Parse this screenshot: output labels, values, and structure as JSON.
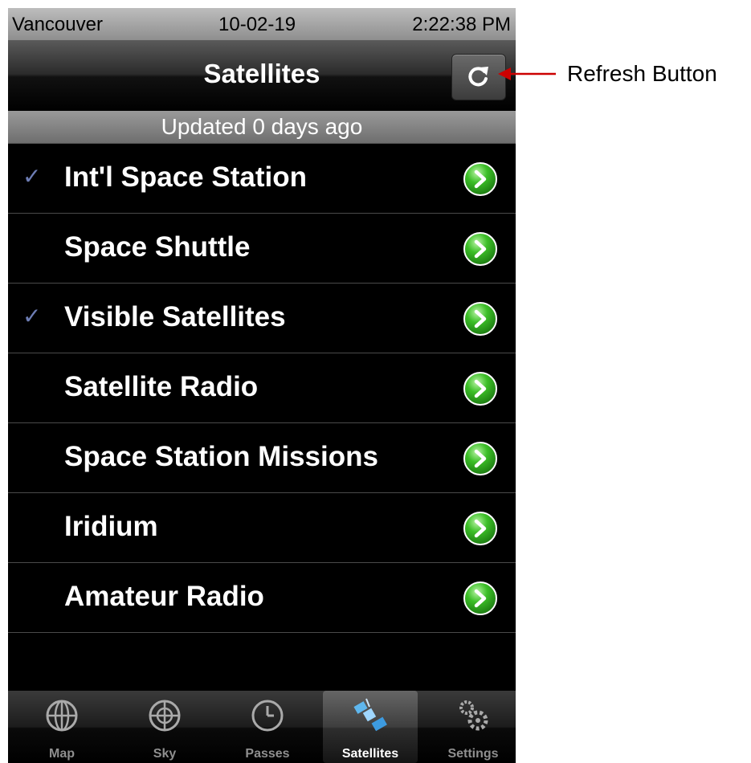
{
  "status_bar": {
    "location": "Vancouver",
    "date": "10-02-19",
    "time": "2:22:38 PM"
  },
  "nav": {
    "title": "Satellites",
    "refresh_icon": "refresh-icon"
  },
  "header": {
    "updated_text": "Updated 0 days ago"
  },
  "satellites": [
    {
      "label": "Int'l Space Station",
      "checked": true
    },
    {
      "label": "Space Shuttle",
      "checked": false
    },
    {
      "label": "Visible Satellites",
      "checked": true
    },
    {
      "label": "Satellite Radio",
      "checked": false
    },
    {
      "label": "Space Station Missions",
      "checked": false
    },
    {
      "label": "Iridium",
      "checked": false
    },
    {
      "label": "Amateur Radio",
      "checked": false
    }
  ],
  "check_glyph": "✓",
  "tabs": [
    {
      "label": "Map",
      "icon": "globe-icon"
    },
    {
      "label": "Sky",
      "icon": "sky-grid-icon"
    },
    {
      "label": "Passes",
      "icon": "clock-icon"
    },
    {
      "label": "Satellites",
      "icon": "satellite-icon",
      "active": true
    },
    {
      "label": "Settings",
      "icon": "gears-icon"
    }
  ],
  "annotation": {
    "label": "Refresh Button"
  },
  "colors": {
    "disclosure_green": "#3cbf27",
    "check_blue": "#6d7db4",
    "arrow_red": "#cc0000"
  }
}
